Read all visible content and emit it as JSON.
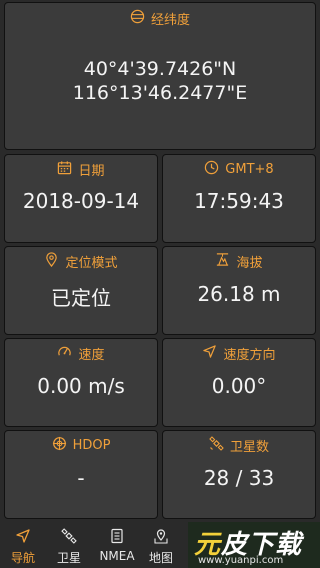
{
  "latlon": {
    "label": "经纬度",
    "lat": "40°4'39.7426\"N",
    "lon": "116°13'46.2477\"E"
  },
  "date": {
    "label": "日期",
    "value": "2018-09-14"
  },
  "time": {
    "label": "GMT+8",
    "value": "17:59:43"
  },
  "fix_mode": {
    "label": "定位模式",
    "value": "已定位"
  },
  "altitude": {
    "label": "海拔",
    "value": "26.18 m"
  },
  "speed": {
    "label": "速度",
    "value": "0.00 m/s"
  },
  "heading": {
    "label": "速度方向",
    "value": "0.00°"
  },
  "hdop": {
    "label": "HDOP",
    "value": "-"
  },
  "satellites": {
    "label": "卫星数",
    "value": "28 / 33"
  },
  "nav": {
    "navigation": "导航",
    "satellite": "卫星",
    "nmea": "NMEA",
    "map": "地图"
  },
  "watermark": {
    "title_a": "元",
    "title_b": "皮下载",
    "url": "www.yuanpi.com"
  },
  "colors": {
    "accent": "#f0a03a",
    "card": "#3b3b3b",
    "background": "#2a2a2a"
  }
}
